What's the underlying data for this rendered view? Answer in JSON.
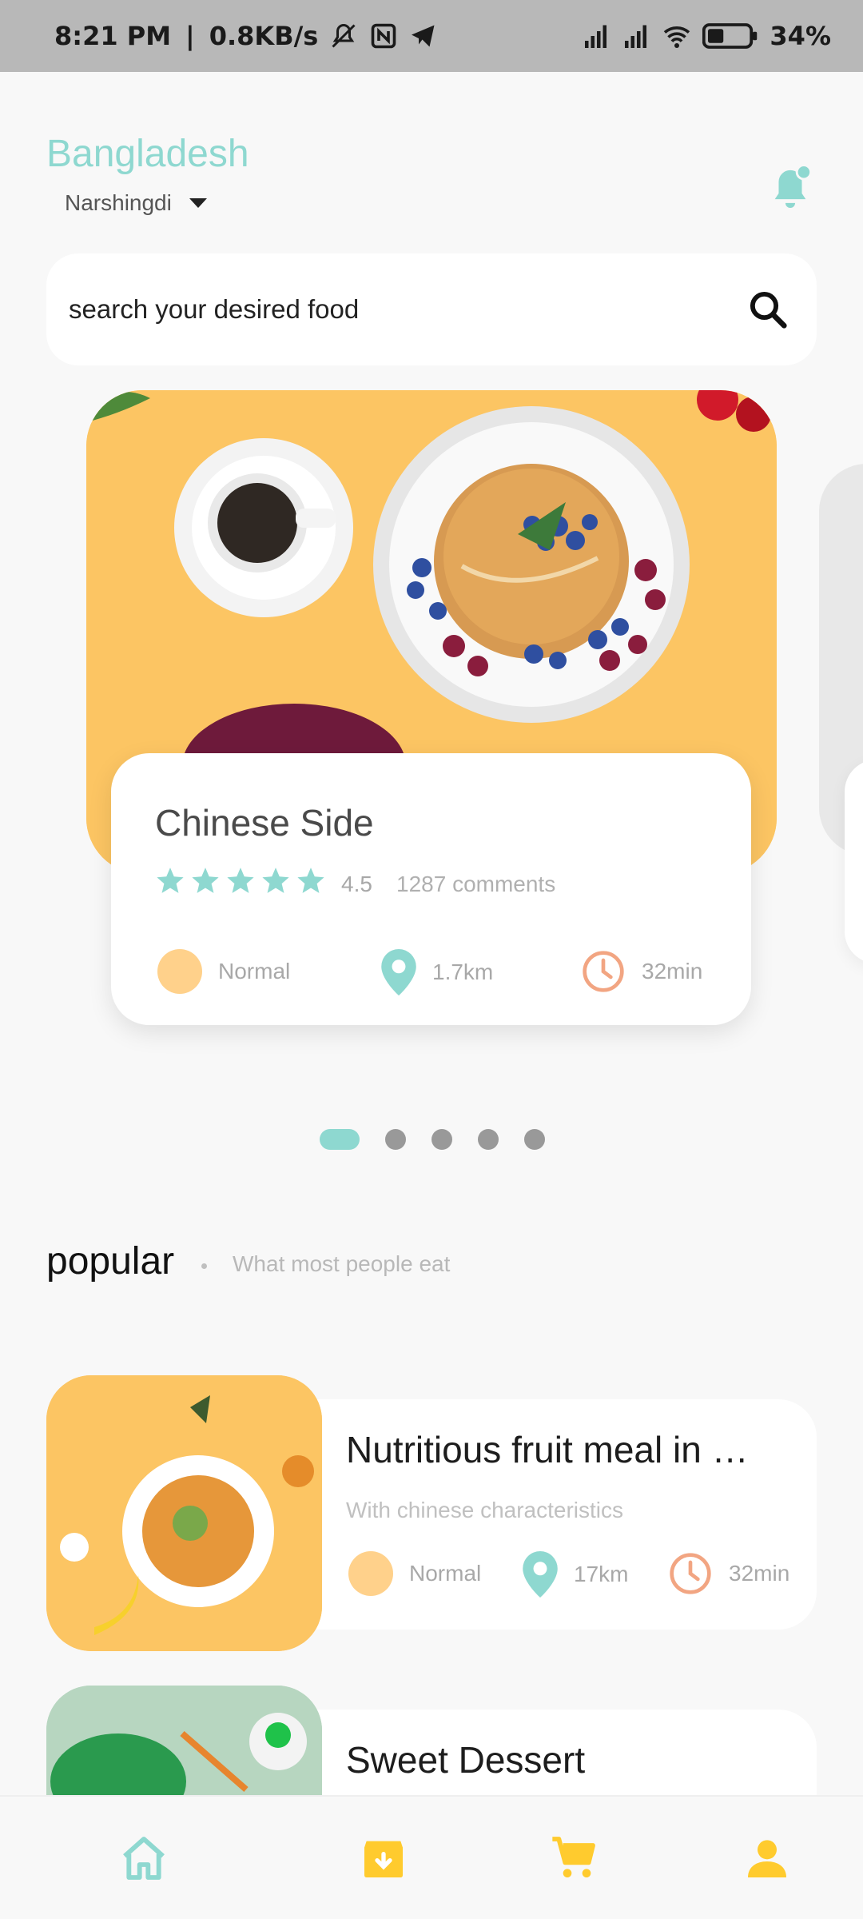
{
  "status_bar": {
    "time": "8:21 PM",
    "separator": "|",
    "speed": "0.8KB/s",
    "battery_percent": "34%",
    "icons": [
      "mute-icon",
      "nfc-icon",
      "telegram-icon",
      "signal-icon",
      "signal-icon",
      "wifi-icon",
      "battery-icon"
    ]
  },
  "location": {
    "country": "Bangladesh",
    "city": "Narshingdi"
  },
  "search": {
    "placeholder": "search your desired food"
  },
  "featured": {
    "title": "Chinese Side",
    "stars": 5,
    "rating": "4.5",
    "comments": "1287 comments",
    "level": "Normal",
    "distance": "1.7km",
    "time": "32min"
  },
  "pager": {
    "count": 5,
    "active": 0
  },
  "popular": {
    "title": "popular",
    "subtitle": "What most people eat",
    "items": [
      {
        "title": "Nutritious fruit meal in …",
        "subtitle": "With chinese characteristics",
        "level": "Normal",
        "distance": "17km",
        "time": "32min"
      },
      {
        "title": "Sweet Dessert"
      }
    ]
  },
  "colors": {
    "accent": "#8ed8d0",
    "yellow": "#fcc563",
    "orange": "#f2a582",
    "nav_yellow": "#ffcb2e"
  },
  "nav": [
    "home-icon",
    "archive-icon",
    "cart-icon",
    "profile-icon"
  ]
}
